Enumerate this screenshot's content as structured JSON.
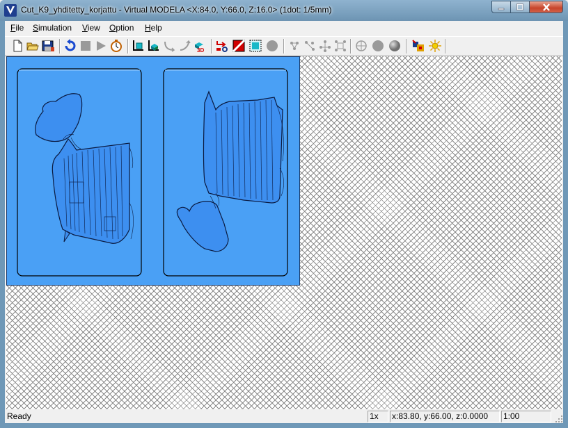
{
  "window": {
    "title": "Cut_K9_yhditetty_korjattu - Virtual MODELA <X:84.0, Y:66.0, Z:16.0> (1dot: 1/5mm)",
    "app_icon": "v-logo-icon",
    "controls": {
      "minimize": "minimize-icon",
      "maximize": "maximize-icon",
      "close": "close-icon"
    }
  },
  "menu": {
    "items": [
      {
        "label": "File"
      },
      {
        "label": "Simulation"
      },
      {
        "label": "View"
      },
      {
        "label": "Option"
      },
      {
        "label": "Help"
      }
    ]
  },
  "toolbar": {
    "buttons": [
      {
        "icon": "new-file-icon"
      },
      {
        "icon": "open-folder-icon"
      },
      {
        "icon": "save-icon"
      },
      {
        "icon": "rewind-icon"
      },
      {
        "icon": "stop-icon"
      },
      {
        "icon": "play-icon"
      },
      {
        "icon": "timer-icon"
      },
      {
        "icon": "view-top-icon"
      },
      {
        "icon": "view-block-icon"
      },
      {
        "icon": "path-curve-icon"
      },
      {
        "icon": "path-line-icon"
      },
      {
        "icon": "view-3d-icon"
      },
      {
        "icon": "toolpath-icon"
      },
      {
        "icon": "material-icon"
      },
      {
        "icon": "area-select-icon"
      },
      {
        "icon": "sphere-gray-icon"
      },
      {
        "icon": "move-points-icon"
      },
      {
        "icon": "move-points-2-icon"
      },
      {
        "icon": "move-points-3-icon"
      },
      {
        "icon": "fit-icon"
      },
      {
        "icon": "light-sphere-1-icon"
      },
      {
        "icon": "light-sphere-2-icon"
      },
      {
        "icon": "light-sphere-3-icon"
      },
      {
        "icon": "color-settings-icon"
      },
      {
        "icon": "light-icon"
      }
    ]
  },
  "colors": {
    "model_background": "#4aa0f5",
    "model_part": "#3d8ff0"
  },
  "status": {
    "ready": "Ready",
    "zoom": "1x",
    "coords": "x:83.80, y:66.00, z:0.0000",
    "time": "1:00"
  }
}
